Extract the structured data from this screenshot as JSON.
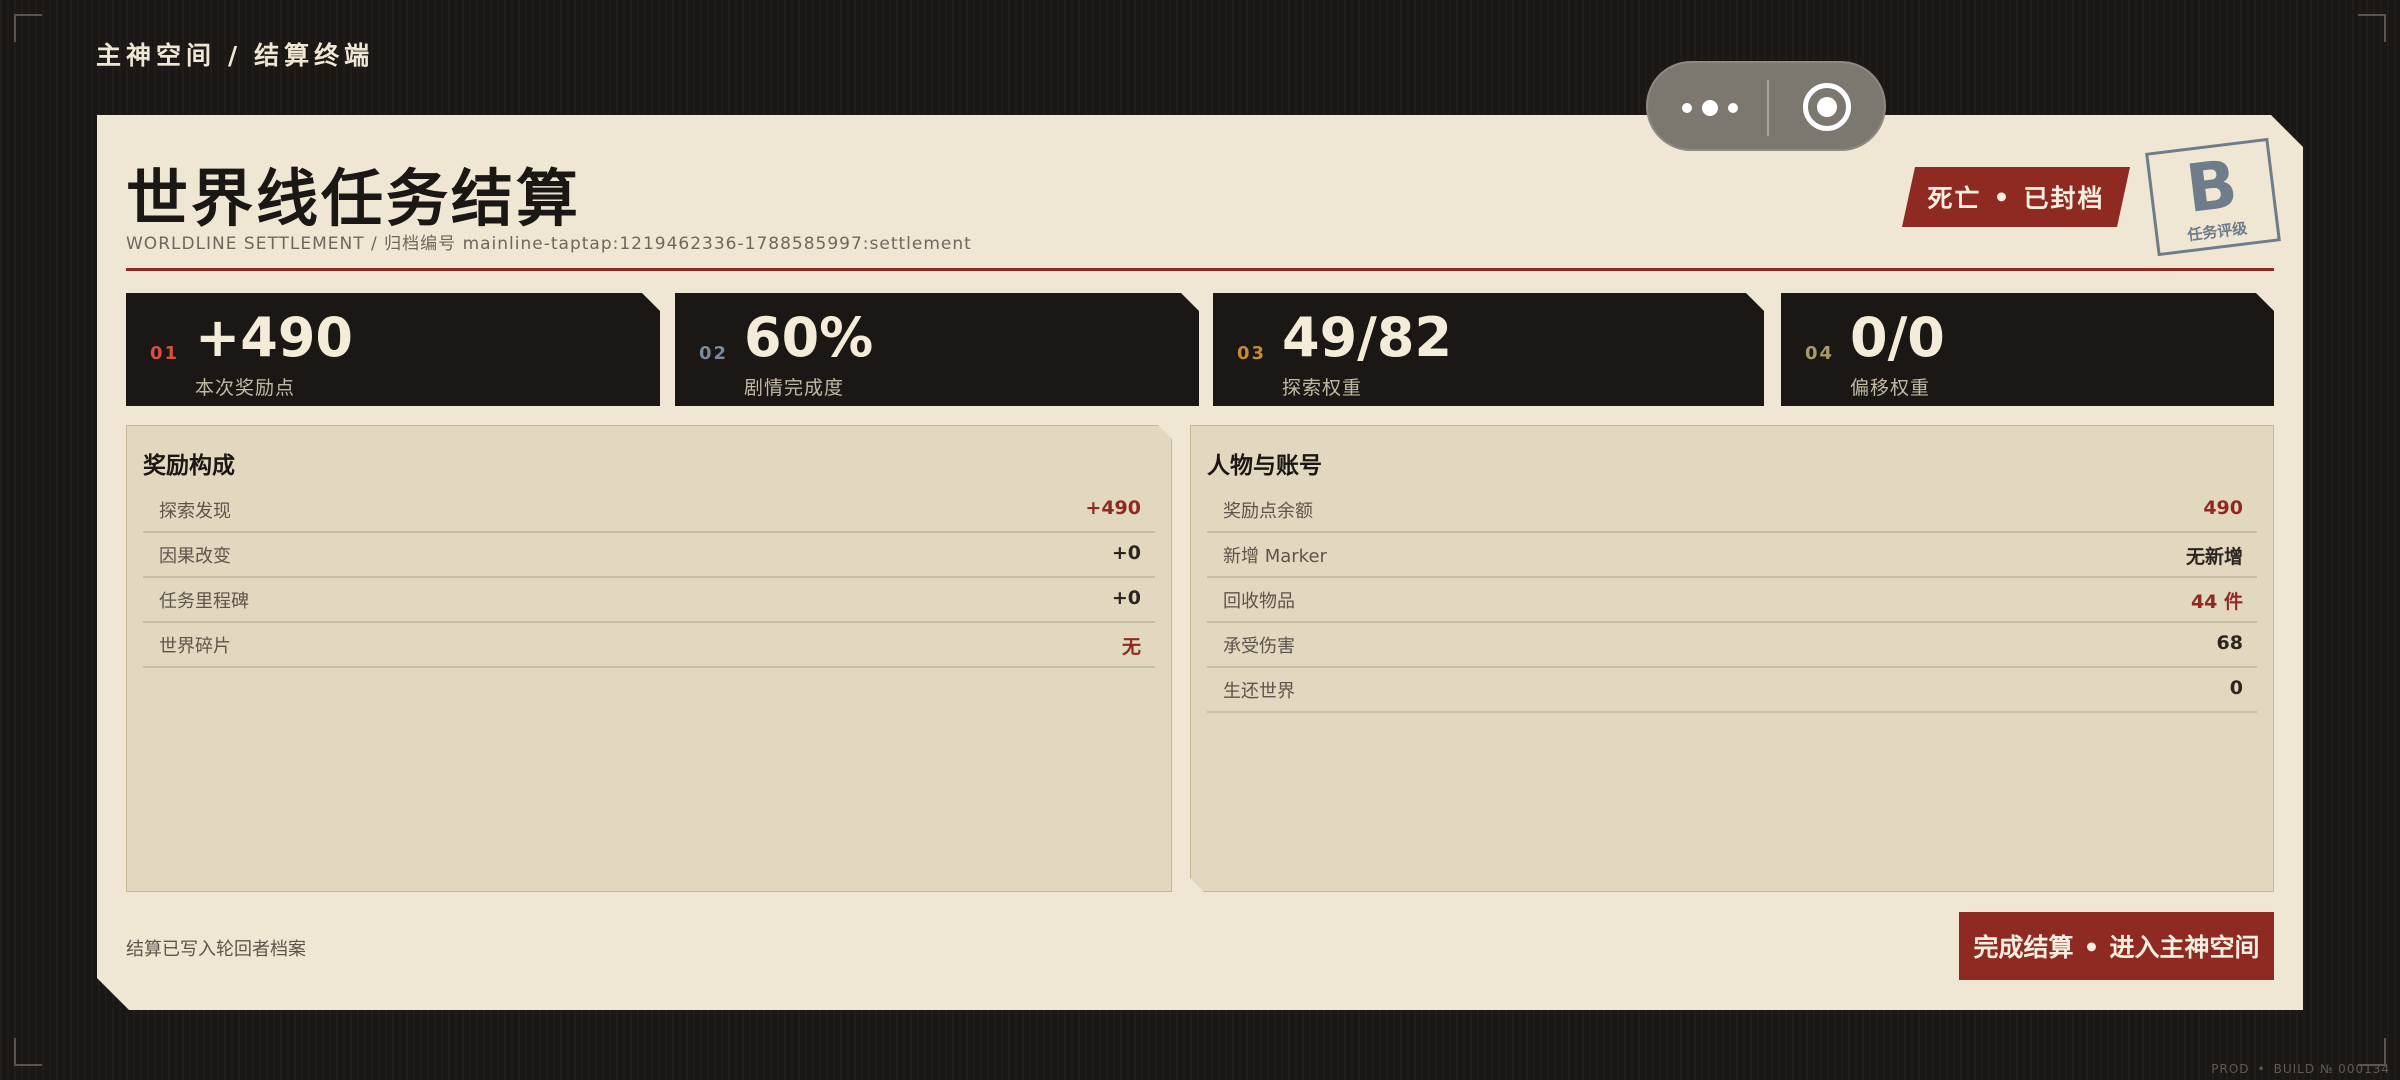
{
  "breadcrumb": {
    "home": "主神空间",
    "separator": "/",
    "current": "结算终端"
  },
  "header": {
    "title": "世界线任务结算",
    "subtitle": "WORLDLINE SETTLEMENT / 归档编号 mainline-taptap:1219462336-1788585997:settlement"
  },
  "status": {
    "left": "死亡",
    "separator": "•",
    "right": "已封档"
  },
  "rank": {
    "letter": "B",
    "label": "任务评级"
  },
  "stats": [
    {
      "index": "01",
      "value": "+490",
      "label": "本次奖励点",
      "index_color": "#d8503c"
    },
    {
      "index": "02",
      "value": "60%",
      "label": "剧情完成度",
      "index_color": "#7a8a9c"
    },
    {
      "index": "03",
      "value": "49/82",
      "label": "探索权重",
      "index_color": "#c8893a"
    },
    {
      "index": "04",
      "value": "0/0",
      "label": "偏移权重",
      "index_color": "#a89a6a"
    }
  ],
  "rewards": {
    "title": "奖励构成",
    "rows": [
      {
        "label": "探索发现",
        "value": "+490",
        "highlight": true
      },
      {
        "label": "因果改变",
        "value": "+0",
        "highlight": false
      },
      {
        "label": "任务里程碑",
        "value": "+0",
        "highlight": false
      },
      {
        "label": "世界碎片",
        "value": "无",
        "highlight": true
      }
    ]
  },
  "account": {
    "title": "人物与账号",
    "rows": [
      {
        "label": "奖励点余额",
        "value": "490",
        "highlight": true
      },
      {
        "label": "新增 Marker",
        "value": "无新增",
        "highlight": false
      },
      {
        "label": "回收物品",
        "value": "44 件",
        "highlight": true
      },
      {
        "label": "承受伤害",
        "value": "68",
        "highlight": false
      },
      {
        "label": "生还世界",
        "value": "0",
        "highlight": false
      }
    ]
  },
  "footer": {
    "note": "结算已写入轮回者档案",
    "button_left": "完成结算",
    "button_separator": "•",
    "button_right": "进入主神空间"
  },
  "build": {
    "env": "PROD",
    "separator": "•",
    "text": "BUILD № 000134"
  },
  "colors": {
    "accent_red": "#8e2a22",
    "panel_bg": "#efe7d4",
    "section_bg": "#e2d7bf",
    "dark": "#1a1714",
    "stamp_blue": "#6e7c8b"
  }
}
